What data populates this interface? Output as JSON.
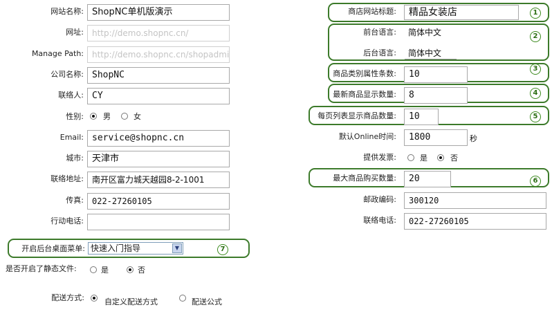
{
  "left": {
    "site_name": {
      "label": "网站名称:",
      "value": "ShopNC单机版演示"
    },
    "url": {
      "label": "网址:",
      "value": "http://demo.shopnc.cn/"
    },
    "manage_path": {
      "label": "Manage Path:",
      "value": "http://demo.shopnc.cn/shopadmin"
    },
    "company": {
      "label": "公司名称:",
      "value": "ShopNC"
    },
    "contact": {
      "label": "联络人:",
      "value": "CY"
    },
    "gender": {
      "label": "性别:",
      "options": [
        "男",
        "女"
      ],
      "selected": "男"
    },
    "email": {
      "label": "Email:",
      "value": "service@shopnc.cn"
    },
    "city": {
      "label": "城市:",
      "value": "天津市"
    },
    "address": {
      "label": "联络地址:",
      "value": "南开区富力城天越园8-2-1001"
    },
    "fax": {
      "label": "传真:",
      "value": "022-27260105"
    },
    "mobile": {
      "label": "行动电话:",
      "value": ""
    }
  },
  "right": {
    "shop_title": {
      "label": "商店网站标题:",
      "value": "精品女装店"
    },
    "front_lang": {
      "label": "前台语言:",
      "value": "简体中文"
    },
    "back_lang": {
      "label": "后台语言:",
      "value": "简体中文"
    },
    "category_attrs": {
      "label": "商品类别属性条数:",
      "value": "10"
    },
    "newest_count": {
      "label": "最新商品显示数量:",
      "value": "8"
    },
    "per_page": {
      "label": "每页列表显示商品数量:",
      "value": "10"
    },
    "online_time": {
      "label": "默认Online时间:",
      "value": "1800",
      "unit": "秒"
    },
    "invoice": {
      "label": "提供发票:",
      "options": [
        "是",
        "否"
      ],
      "selected": "否"
    },
    "max_buy": {
      "label": "最大商品购买数量:",
      "value": "20"
    },
    "zip": {
      "label": "邮政编码:",
      "value": "300120"
    },
    "phone": {
      "label": "联络电话:",
      "value": "022-27260105"
    }
  },
  "bottom": {
    "desktop_menu": {
      "label": "开启后台桌面菜单:",
      "value": "快速入门指导"
    },
    "static_file": {
      "label": "是否开启了静态文件:",
      "options": [
        "是",
        "否"
      ],
      "selected": "否"
    },
    "delivery": {
      "label": "配送方式:",
      "options": [
        "自定义配送方式",
        "配送公式"
      ],
      "selected": "自定义配送方式"
    }
  },
  "markers": [
    "1",
    "2",
    "3",
    "4",
    "5",
    "6",
    "7"
  ],
  "colors": {
    "highlight_border": "#3c7a2a",
    "marker": "#3c8a1e"
  }
}
